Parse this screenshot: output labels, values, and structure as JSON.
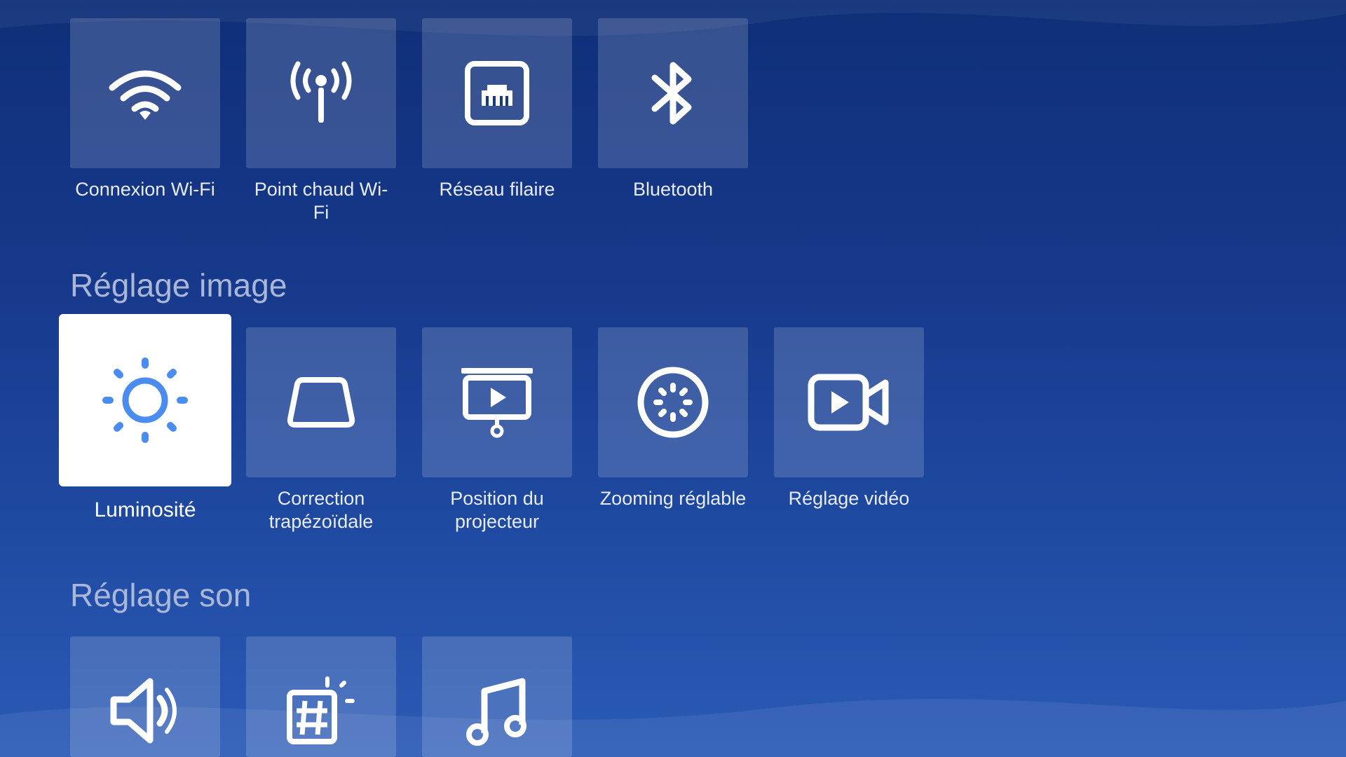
{
  "network": {
    "items": [
      {
        "label": "Connexion Wi-Fi",
        "icon": "wifi-icon"
      },
      {
        "label": "Point chaud Wi-Fi",
        "icon": "hotspot-icon"
      },
      {
        "label": "Réseau filaire",
        "icon": "ethernet-icon"
      },
      {
        "label": "Bluetooth",
        "icon": "bluetooth-icon"
      }
    ]
  },
  "image_section": {
    "title": "Réglage image",
    "items": [
      {
        "label": "Luminosité",
        "icon": "brightness-icon",
        "selected": true
      },
      {
        "label": "Correction trapézoïdale",
        "icon": "keystone-icon"
      },
      {
        "label": "Position du projecteur",
        "icon": "projector-position-icon"
      },
      {
        "label": "Zooming réglable",
        "icon": "zoom-dial-icon"
      },
      {
        "label": "Réglage vidéo",
        "icon": "video-camera-icon"
      }
    ]
  },
  "sound_section": {
    "title": "Réglage son",
    "items": [
      {
        "icon": "speaker-icon"
      },
      {
        "icon": "sound-effect-icon"
      },
      {
        "icon": "music-note-icon"
      }
    ]
  },
  "colors": {
    "accent": "#4a8cf0",
    "tile_bg": "rgba(255,255,255,0.16)",
    "selected_bg": "#ffffff"
  }
}
